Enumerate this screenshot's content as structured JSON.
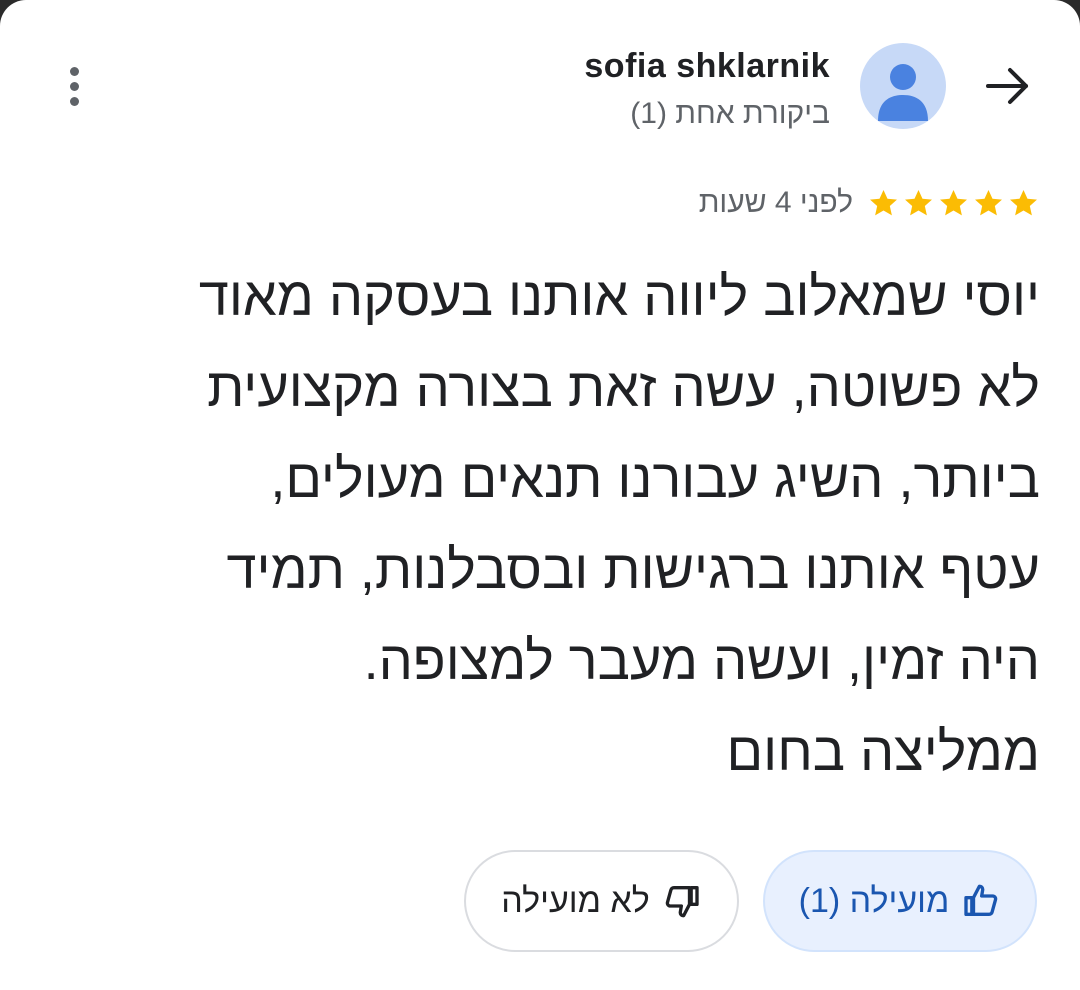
{
  "review": {
    "author_name": "sofia shklarnik",
    "author_reviews": "ביקורת אחת (1)",
    "rating": 5,
    "rating_max": 5,
    "time_ago": "לפני 4 שעות",
    "text": "יוסי שמאלוב ליווה אותנו בעסקה מאוד\nלא פשוטה, עשה זאת בצורה מקצועית\nביותר, השיג עבורנו תנאים מעולים,\nעטף אותנו ברגישות ובסבלנות, תמיד\nהיה זמין, ועשה מעבר למצופה.\nממליצה בחום"
  },
  "actions": {
    "helpful_label": "מועילה (1)",
    "not_helpful_label": "לא מועילה"
  },
  "colors": {
    "star": "#fbbc04",
    "accent": "#1a56b0",
    "avatar_bg": "#c7d9f7",
    "avatar_fg": "#4a82e0"
  },
  "icons": {
    "menu": "more-vert-icon",
    "back": "arrow-right-icon",
    "avatar": "person-icon",
    "star": "star-icon",
    "helpful": "thumb-up-icon",
    "not_helpful": "thumb-down-icon"
  }
}
